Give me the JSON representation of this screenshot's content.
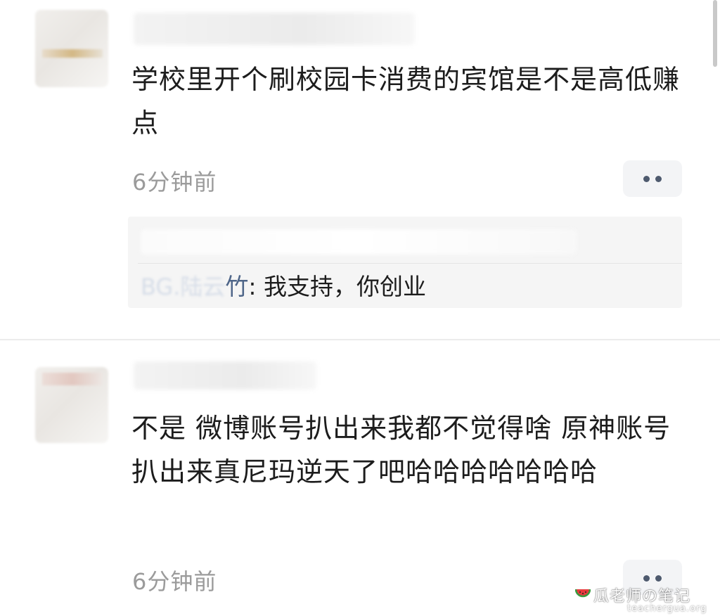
{
  "comments": [
    {
      "text": "学校里开个刷校园卡消费的宾馆是不是高低赚点",
      "timestamp": "6分钟前",
      "reply": {
        "author_visible": "BG.陆云",
        "author_last": "竹",
        "separator": ": ",
        "text": "我支持，你创业"
      }
    },
    {
      "text": "不是 微博账号扒出来我都不觉得啥 原神账号扒出来真尼玛逆天了吧哈哈哈哈哈哈哈",
      "timestamp": "6分钟前"
    }
  ],
  "icons": {
    "more": "more-dots-icon",
    "watermark_logo": "watermelon-icon"
  },
  "watermark": {
    "brand": "瓜老师の笔记",
    "site": "teachergua.org"
  },
  "colors": {
    "timestamp": "#9b9b9b",
    "reply_author": "#4f6689",
    "reply_box": "#f5f5f5",
    "more_button": "#f3f4f6"
  }
}
